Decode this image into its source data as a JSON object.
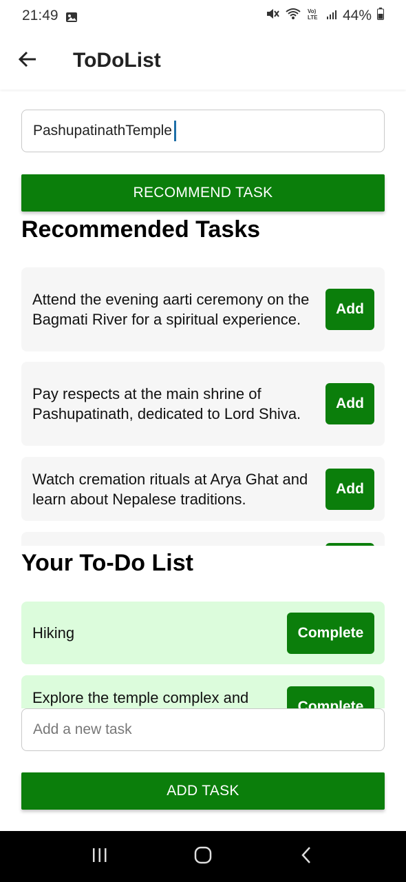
{
  "status_bar": {
    "time": "21:49",
    "battery": "44%"
  },
  "app_bar": {
    "title": "ToDoList"
  },
  "place_input": {
    "value": "PashupatinathTemple"
  },
  "recommend_button": {
    "label": "RECOMMEND TASK"
  },
  "recommended": {
    "heading": "Recommended Tasks",
    "add_label": "Add",
    "items": [
      {
        "text": "Attend the evening aarti ceremony on the Bagmati River for a spiritual experience."
      },
      {
        "text": "Pay respects at the main shrine of Pashupatinath, dedicated to Lord Shiva."
      },
      {
        "text": "Watch cremation rituals at Arya Ghat and learn about Nepalese traditions."
      }
    ]
  },
  "todo": {
    "heading": "Your To-Do List",
    "complete_label": "Complete",
    "items": [
      {
        "text": "Hiking"
      },
      {
        "text": "Explore the temple complex and"
      }
    ]
  },
  "new_task_input": {
    "placeholder": "Add a new task"
  },
  "add_task_button": {
    "label": "ADD TASK"
  },
  "colors": {
    "primary_green": "#0b7e0b",
    "todo_bg": "#dcfcdc",
    "rec_bg": "#f6f6f6"
  }
}
